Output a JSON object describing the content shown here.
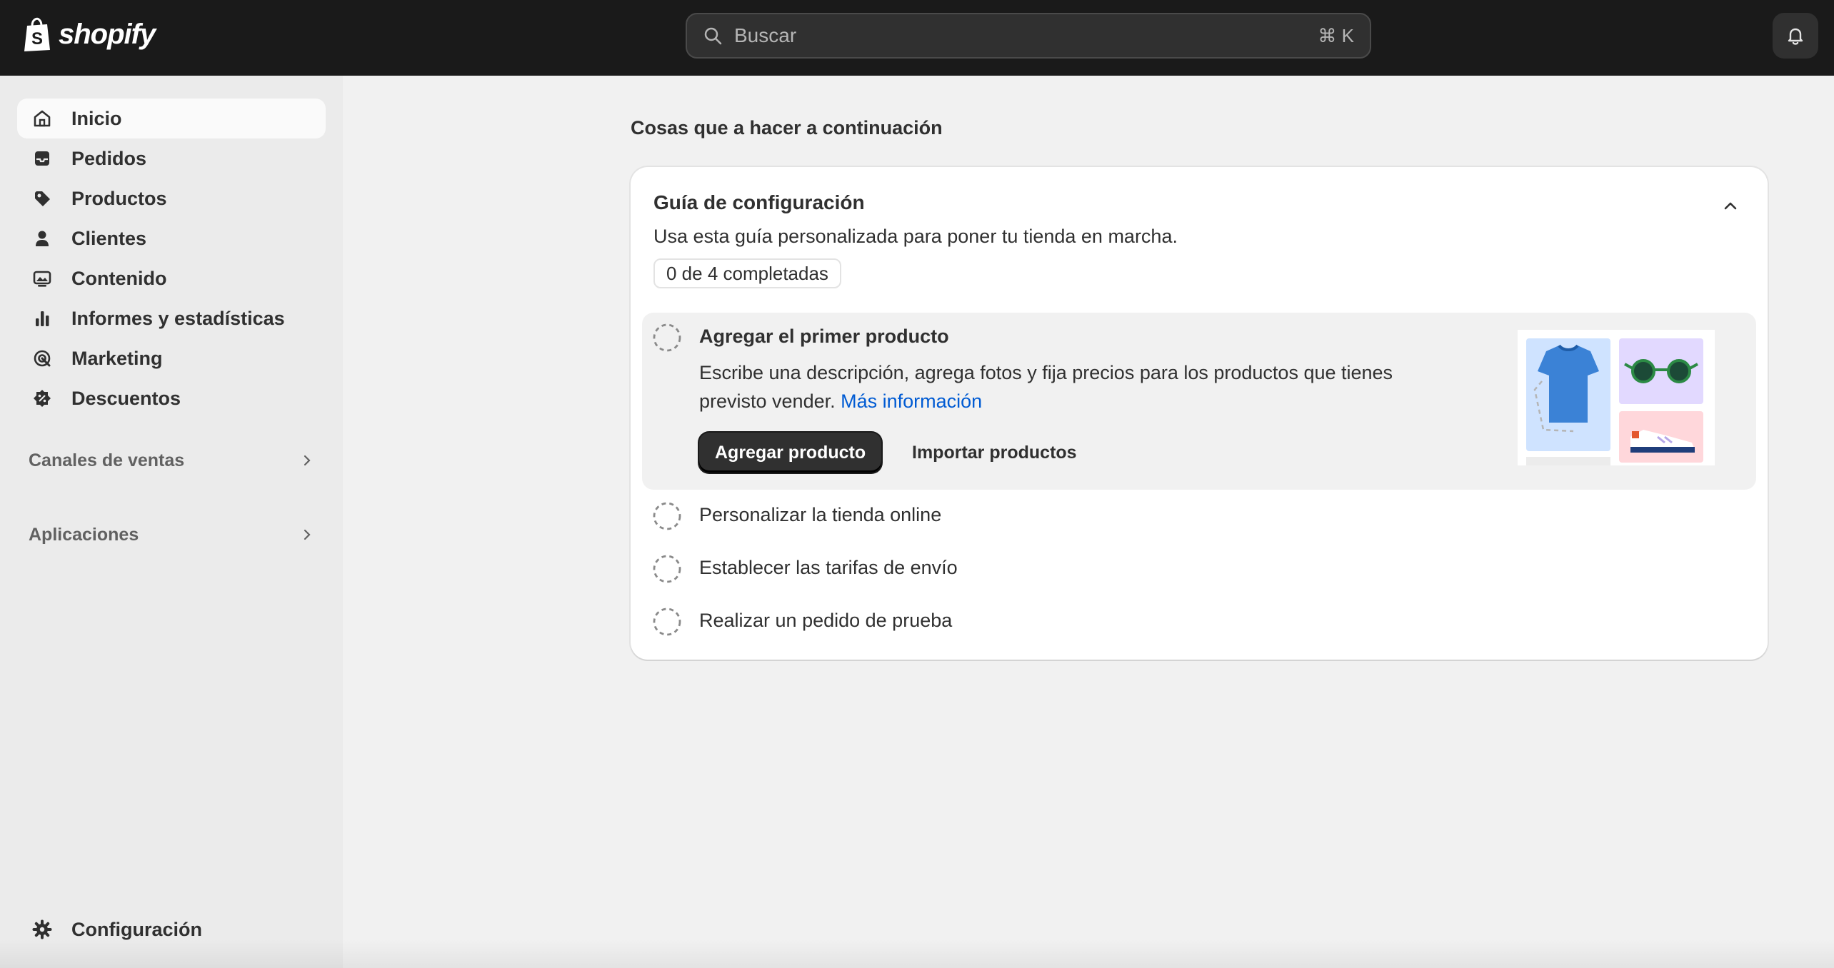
{
  "topbar": {
    "brand": "shopify",
    "search_placeholder": "Buscar",
    "search_shortcut": "⌘ K"
  },
  "sidebar": {
    "items": [
      {
        "label": "Inicio",
        "icon": "home-icon",
        "active": true
      },
      {
        "label": "Pedidos",
        "icon": "inbox-icon"
      },
      {
        "label": "Productos",
        "icon": "tag-icon"
      },
      {
        "label": "Clientes",
        "icon": "person-icon"
      },
      {
        "label": "Contenido",
        "icon": "image-icon"
      },
      {
        "label": "Informes y estadísticas",
        "icon": "bar-chart-icon"
      },
      {
        "label": "Marketing",
        "icon": "target-icon"
      },
      {
        "label": "Descuentos",
        "icon": "discount-icon"
      }
    ],
    "sections": [
      {
        "label": "Canales de ventas"
      },
      {
        "label": "Aplicaciones"
      }
    ],
    "settings_label": "Configuración"
  },
  "main": {
    "section_title": "Cosas que a hacer a continuación",
    "guide": {
      "title": "Guía de configuración",
      "description": "Usa esta guía personalizada para poner tu tienda en marcha.",
      "progress": "0 de 4 completadas",
      "tasks": [
        {
          "title": "Agregar el primer producto",
          "body": "Escribe una descripción, agrega fotos y fija precios para los productos que tienes previsto vender.",
          "link": "Más información",
          "primary_button": "Agregar producto",
          "secondary_button": "Importar productos"
        },
        {
          "title": "Personalizar la tienda online"
        },
        {
          "title": "Establecer las tarifas de envío"
        },
        {
          "title": "Realizar un pedido de prueba"
        }
      ]
    }
  },
  "colors": {
    "topbar": "#1a1a1a",
    "link": "#005bd3",
    "primary_button": "#303030"
  }
}
